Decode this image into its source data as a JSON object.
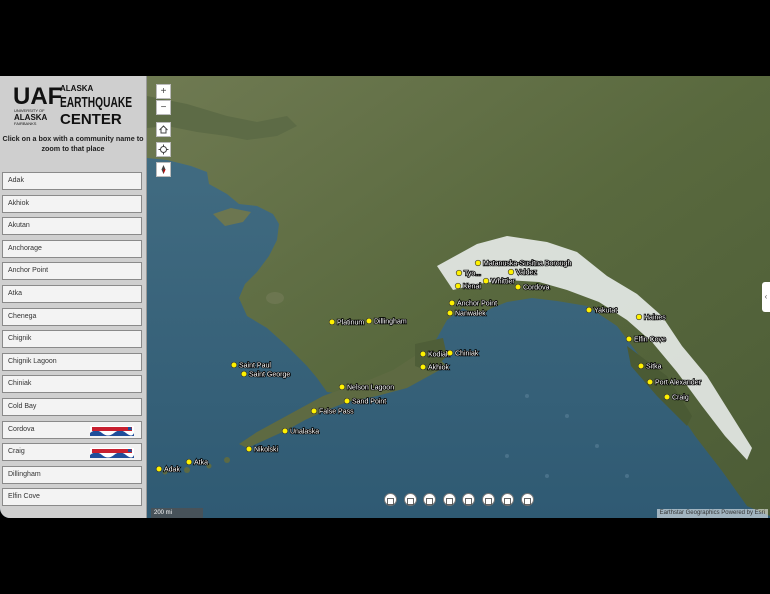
{
  "sidebar": {
    "logo": {
      "mark": "UAF",
      "univ_line1": "UNIVERSITY OF",
      "univ_line2": "ALASKA",
      "univ_line3": "FAIRBANKS",
      "center_line1": "ALASKA",
      "center_line2": "EARTHQUAKE",
      "center_line3": "CENTER"
    },
    "instruction": "Click on a box with a community name to zoom to that place",
    "communities": [
      {
        "name": "Adak",
        "tsunami_ready": false
      },
      {
        "name": "Akhiok",
        "tsunami_ready": false
      },
      {
        "name": "Akutan",
        "tsunami_ready": false
      },
      {
        "name": "Anchorage",
        "tsunami_ready": false
      },
      {
        "name": "Anchor Point",
        "tsunami_ready": false
      },
      {
        "name": "Atka",
        "tsunami_ready": false
      },
      {
        "name": "Chenega",
        "tsunami_ready": false
      },
      {
        "name": "Chignik",
        "tsunami_ready": false
      },
      {
        "name": "Chignik Lagoon",
        "tsunami_ready": false
      },
      {
        "name": "Chiniak",
        "tsunami_ready": false
      },
      {
        "name": "Cold Bay",
        "tsunami_ready": false
      },
      {
        "name": "Cordova",
        "tsunami_ready": true
      },
      {
        "name": "Craig",
        "tsunami_ready": true
      },
      {
        "name": "Dillingham",
        "tsunami_ready": false
      },
      {
        "name": "Elfin Cove",
        "tsunami_ready": false
      }
    ]
  },
  "map": {
    "zoom_in_label": "+",
    "zoom_out_label": "−",
    "scale_label": "200 mi",
    "attribution": "Earthstar Geographics   Powered by Esri",
    "side_tab_icon": "chevron-left-icon",
    "toolbar_icons": [
      "layers-icon",
      "grid-icon",
      "measure-icon",
      "elevation-icon",
      "locate-icon",
      "print-icon",
      "tree-icon",
      "basemap-icon"
    ],
    "places": [
      {
        "label": "Matanuska-Susitna Borough"
      },
      {
        "label": "Valdez"
      },
      {
        "label": "Tyo..."
      },
      {
        "label": "Whittier"
      },
      {
        "label": "Kenai"
      },
      {
        "label": "Cordova"
      },
      {
        "label": "Anchor Point"
      },
      {
        "label": "Nanwalek"
      },
      {
        "label": "Platinum"
      },
      {
        "label": "Dillingham"
      },
      {
        "label": "Yakutat"
      },
      {
        "label": "Haines"
      },
      {
        "label": "Elfin Cove"
      },
      {
        "label": "Kodiak"
      },
      {
        "label": "Chiniak"
      },
      {
        "label": "Akhiok"
      },
      {
        "label": "Sitka"
      },
      {
        "label": "Port Alexander"
      },
      {
        "label": "Craig"
      },
      {
        "label": "Saint Paul"
      },
      {
        "label": "Saint George"
      },
      {
        "label": "Nelson Lagoon"
      },
      {
        "label": "Sand Point"
      },
      {
        "label": "False Pass"
      },
      {
        "label": "Unalaska"
      },
      {
        "label": "Nikolski"
      },
      {
        "label": "Atka"
      },
      {
        "label": "Adak"
      }
    ]
  },
  "colors": {
    "marker": "#fff200",
    "sidebar_bg": "#cfcfcf",
    "badge_red": "#c8202f",
    "badge_blue": "#1f4e9a"
  }
}
